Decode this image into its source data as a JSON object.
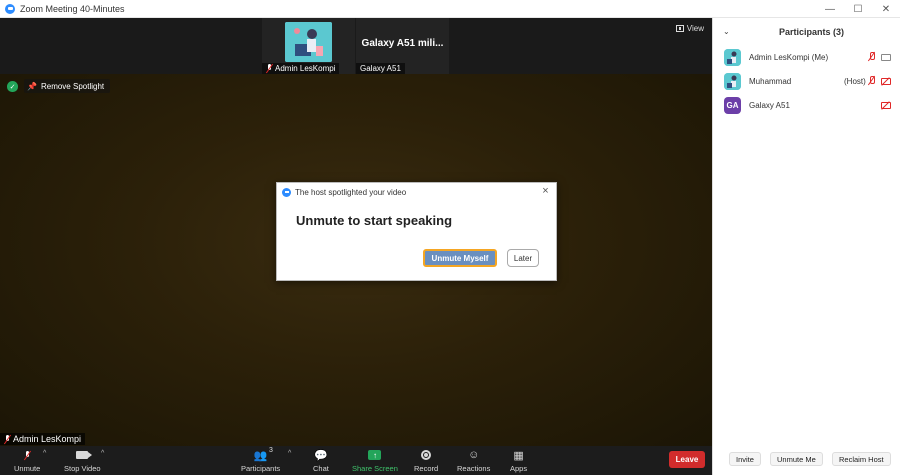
{
  "window": {
    "title": "Zoom Meeting 40-Minutes"
  },
  "thumbs": [
    {
      "name": "Admin LesKompi",
      "type": "image"
    },
    {
      "big_name": "Galaxy A51 mili...",
      "name": "Galaxy A51"
    }
  ],
  "view_label": "View",
  "spotlight": {
    "remove_label": "Remove Spotlight"
  },
  "stage_name_tag": "Admin LesKompi",
  "dialog": {
    "header": "The host spotlighted your video",
    "message": "Unmute to start speaking",
    "primary": "Unmute Myself",
    "secondary": "Later"
  },
  "toolbar": {
    "unmute": "Unmute",
    "stop_video": "Stop Video",
    "participants": "Participants",
    "participants_count": "3",
    "chat": "Chat",
    "share_screen": "Share Screen",
    "record": "Record",
    "reactions": "Reactions",
    "apps": "Apps",
    "leave": "Leave"
  },
  "panel": {
    "title": "Participants (3)",
    "participants": [
      {
        "name": "Admin LesKompi (Me)",
        "role": "",
        "avatar": "image",
        "mic": "muted",
        "cam": "on"
      },
      {
        "name": "Muhammad",
        "role": "(Host)",
        "avatar": "image",
        "mic": "muted",
        "cam": "off"
      },
      {
        "name": "Galaxy A51",
        "role": "",
        "avatar": "GA",
        "mic": "",
        "cam": "off"
      }
    ],
    "buttons": {
      "invite": "Invite",
      "unmute_me": "Unmute Me",
      "reclaim_host": "Reclaim Host"
    }
  },
  "colors": {
    "accent": "#2d8cff",
    "leave": "#d12c2c",
    "share": "#23a55a",
    "avatar_initials": "#6c3fa8"
  }
}
